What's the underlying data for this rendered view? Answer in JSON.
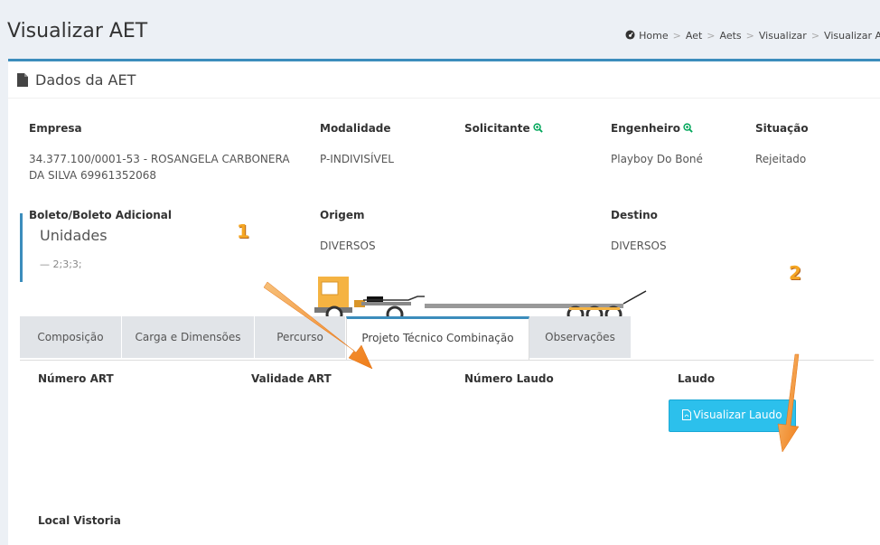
{
  "header": {
    "title": "Visualizar AET",
    "breadcrumb": [
      "Home",
      "Aet",
      "Aets",
      "Visualizar",
      "Visualizar A"
    ]
  },
  "box": {
    "title": "Dados da AET"
  },
  "fields": {
    "empresa": {
      "label": "Empresa",
      "value_line1": "34.377.100/0001-53 - ROSANGELA CARBONERA",
      "value_line2": "DA SILVA 69961352068"
    },
    "modalidade": {
      "label": "Modalidade",
      "value": "P-INDIVISÍVEL"
    },
    "solicitante": {
      "label": "Solicitante",
      "value": ""
    },
    "engenheiro": {
      "label": "Engenheiro",
      "value": "Playboy Do Boné"
    },
    "situacao": {
      "label": "Situação",
      "value": "Rejeitado"
    },
    "boleto": {
      "label": "Boleto/Boleto Adicional",
      "value": ""
    },
    "origem": {
      "label": "Origem",
      "value": "DIVERSOS"
    },
    "destino": {
      "label": "Destino",
      "value": "DIVERSOS"
    }
  },
  "unidades": {
    "title": "Unidades",
    "value": "— 2;3;3;"
  },
  "tabs": [
    {
      "label": "Composição",
      "active": false
    },
    {
      "label": "Carga e Dimensões",
      "active": false
    },
    {
      "label": "Percurso",
      "active": false
    },
    {
      "label": "Projeto Técnico Combinação",
      "active": true
    },
    {
      "label": "Observações",
      "active": false
    }
  ],
  "tab_content": {
    "numero_art": "Número ART",
    "validade_art": "Validade ART",
    "numero_laudo": "Número Laudo",
    "laudo": "Laudo",
    "visualizar_laudo": "Visualizar Laudo",
    "local_vistoria": "Local Vistoria"
  },
  "annotations": {
    "one": "1",
    "two": "2"
  },
  "colors": {
    "accent": "#3c8dbc",
    "button": "#2cc0ec",
    "annotation": "#f5a623",
    "truck_cab": "#f5b342"
  }
}
